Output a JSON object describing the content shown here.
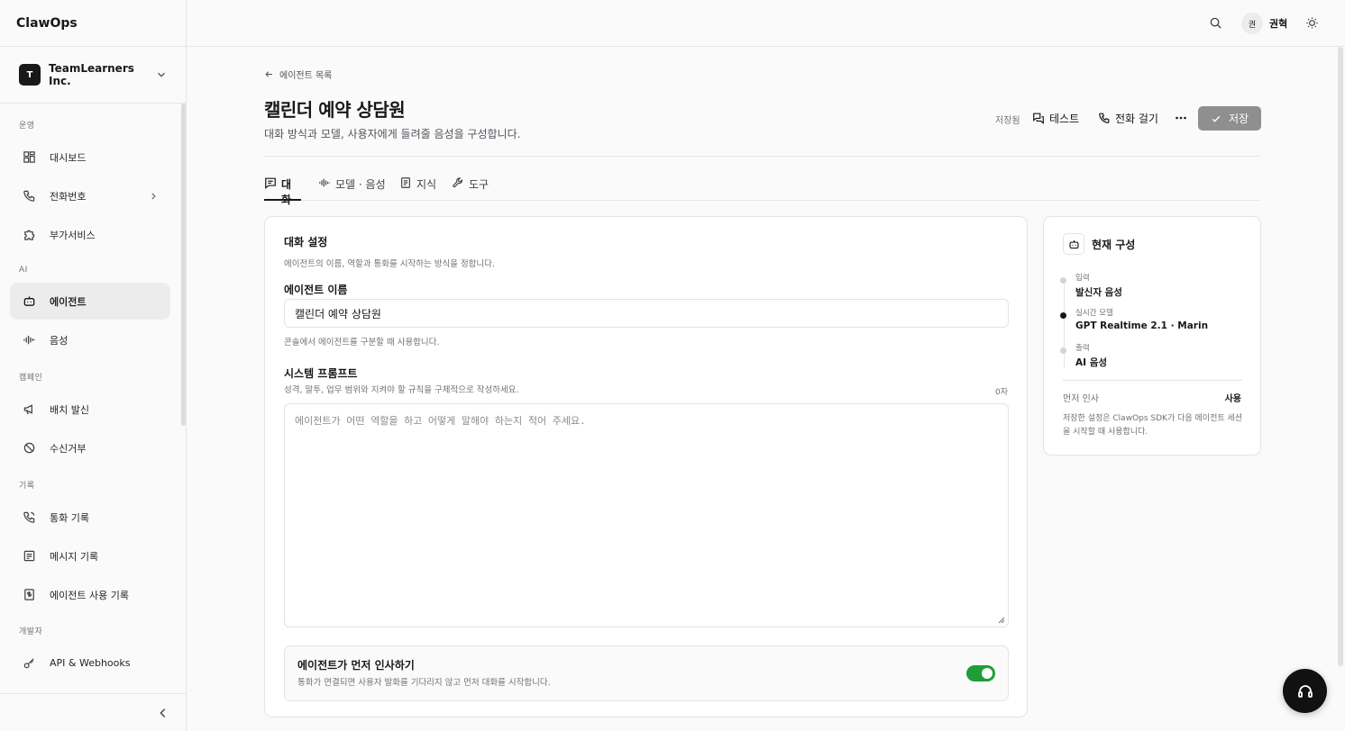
{
  "app": {
    "brand": "ClawOps"
  },
  "org": {
    "avatar_letter": "T",
    "name": "TeamLearners Inc."
  },
  "sidebar": {
    "sections": [
      {
        "label": "운영",
        "items": [
          {
            "label": "대시보드",
            "icon": "dashboard-icon"
          },
          {
            "label": "전화번호",
            "icon": "phone-icon",
            "has_children": true
          },
          {
            "label": "부가서비스",
            "icon": "puzzle-icon"
          }
        ]
      },
      {
        "label": "AI",
        "items": [
          {
            "label": "에이전트",
            "icon": "bot-icon",
            "active": true
          },
          {
            "label": "음성",
            "icon": "audio-wave-icon"
          }
        ]
      },
      {
        "label": "캠페인",
        "items": [
          {
            "label": "배치 발신",
            "icon": "megaphone-icon"
          },
          {
            "label": "수신거부",
            "icon": "ban-icon"
          }
        ]
      },
      {
        "label": "기록",
        "items": [
          {
            "label": "통화 기록",
            "icon": "phone-log-icon"
          },
          {
            "label": "메시지 기록",
            "icon": "message-icon"
          },
          {
            "label": "에이전트 사용 기록",
            "icon": "receipt-icon"
          }
        ]
      },
      {
        "label": "개발자",
        "items": [
          {
            "label": "API & Webhooks",
            "icon": "key-icon"
          }
        ]
      }
    ]
  },
  "topbar": {
    "user_avatar": "권",
    "user_name": "권혁"
  },
  "page": {
    "back_label": "에이전트 목록",
    "title": "캘린더 예약 상담원",
    "subtitle": "대화 방식과 모델, 사용자에게 들려줄 음성을 구성합니다.",
    "saved_status": "저장됨",
    "test_label": "테스트",
    "call_label": "전화 걸기",
    "save_label": "저장"
  },
  "tabs": [
    {
      "label": "대화",
      "icon": "chat-icon",
      "active": true
    },
    {
      "label": "모델 · 음성",
      "icon": "audio-wave-icon"
    },
    {
      "label": "지식",
      "icon": "document-icon"
    },
    {
      "label": "도구",
      "icon": "wrench-icon"
    }
  ],
  "conversation": {
    "title": "대화 설정",
    "description": "에이전트의 이름, 역할과 통화를 시작하는 방식을 정합니다.",
    "name_label": "에이전트 이름",
    "name_value": "캘린더 예약 상담원",
    "name_hint": "콘솔에서 에이전트를 구분할 때 사용합니다.",
    "prompt_label": "시스템 프롬프트",
    "prompt_hint": "성격, 말투, 업무 범위와 지켜야 할 규칙을 구체적으로 작성하세요.",
    "prompt_count": "0자",
    "prompt_placeholder": "에이전트가 어떤 역할을 하고 어떻게 말해야 하는지 적어 주세요.",
    "greet_title": "에이전트가 먼저 인사하기",
    "greet_description": "통화가 연결되면 사용자 발화를 기다리지 않고 먼저 대화를 시작합니다.",
    "greet_enabled": true
  },
  "current_config": {
    "title": "현재 구성",
    "steps": [
      {
        "label": "입력",
        "value": "발신자 음성",
        "active": false
      },
      {
        "label": "실시간 모델",
        "value": "GPT Realtime 2.1 · Marin",
        "active": true
      },
      {
        "label": "출력",
        "value": "AI 음성",
        "active": false
      }
    ],
    "greet_label": "먼저 인사",
    "greet_value": "사용",
    "note": "저장한 설정은 ClawOps SDK가 다음 에이전트 세션을 시작할 때 사용합니다."
  },
  "colors": {
    "toggle_on": "#1f9d3a",
    "save_button": "#8f8f8f",
    "active_nav": "#ececec"
  }
}
